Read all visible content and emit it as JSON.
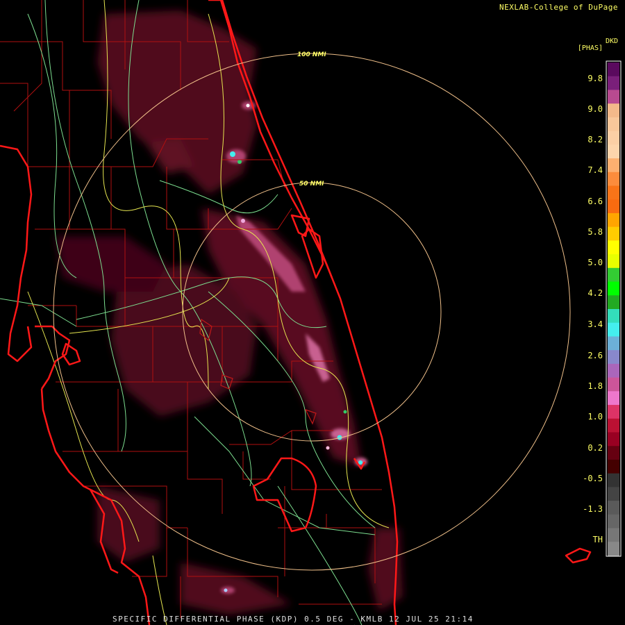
{
  "header": {
    "credit": "NEXLAB-College of DuPage"
  },
  "colorbar": {
    "unit_top": "DKD",
    "unit_left": "[PHAS]",
    "labels": [
      "9.8",
      "9.0",
      "8.2",
      "7.4",
      "6.6",
      "5.8",
      "5.0",
      "4.2",
      "3.4",
      "2.6",
      "1.8",
      "1.0",
      "0.2",
      "-0.5",
      "-1.3",
      "TH"
    ],
    "colors_top_to_bottom": [
      "#5a0a5e",
      "#7a1f7a",
      "#b84a90",
      "#f4b98a",
      "#f9c79a",
      "#fbcfa5",
      "#fdd5ac",
      "#fdb070",
      "#fc8c3c",
      "#f97418",
      "#f96b10",
      "#ffa500",
      "#ffcc00",
      "#ffff00",
      "#e8ff00",
      "#33cc33",
      "#00ff00",
      "#22aa22",
      "#33ddbb",
      "#44eeee",
      "#6cb0d8",
      "#8888cc",
      "#aa66bb",
      "#cc5599",
      "#ee77cc",
      "#dd3366",
      "#bb1133",
      "#990022",
      "#660011",
      "#440000",
      "#333333",
      "#444444",
      "#5a5a5a",
      "#666666",
      "#777777",
      "#888888"
    ]
  },
  "rings": [
    {
      "label": "100 NMI"
    },
    {
      "label": "50 NMI"
    }
  ],
  "footer": {
    "caption": "SPECIFIC DIFFERENTIAL PHASE (KDP) 0.5 DEG - KMLB 12 JUL 25 21:14"
  }
}
